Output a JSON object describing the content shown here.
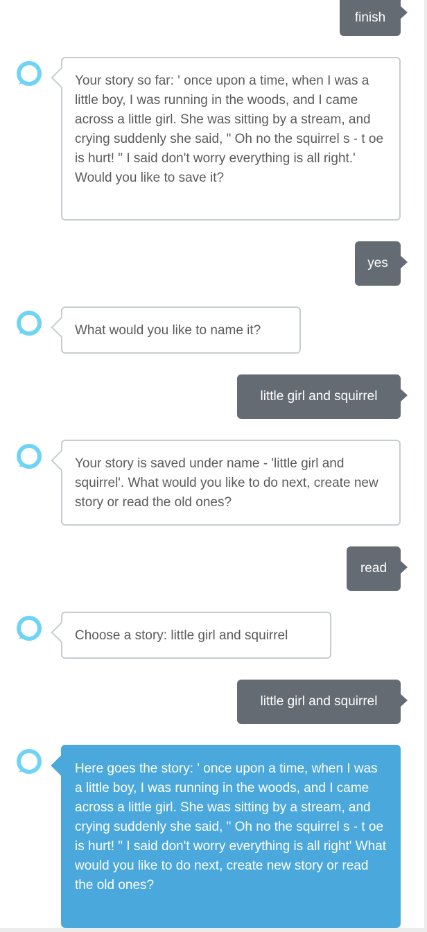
{
  "accent_colors": {
    "user_bubble": "#646b73",
    "bot_bubble_border": "#c7cdcf",
    "bot_highlight": "#4aa8dc",
    "avatar_ring": "#6fd4f4"
  },
  "icons": {
    "avatar": "alexa-ring-icon"
  },
  "messages": [
    {
      "sender": "user",
      "text": "finish"
    },
    {
      "sender": "bot",
      "text": "Your story so far: ' once upon a time, when I was a little boy, I was running in the woods, and I came across a little girl. She was sitting by a stream, and crying suddenly she said, \" Oh no the squirrel s - t oe is hurt! \" I said don't worry everything is all right.' Would you like to save it?"
    },
    {
      "sender": "user",
      "text": "yes"
    },
    {
      "sender": "bot",
      "text": "What would you like to name it?"
    },
    {
      "sender": "user",
      "text": "little girl and squirrel"
    },
    {
      "sender": "bot",
      "text": "Your story is saved under name - 'little girl and squirrel'. What would you like to do next, create new story or read the old ones?"
    },
    {
      "sender": "user",
      "text": "read"
    },
    {
      "sender": "bot",
      "text": "Choose a story: little girl and squirrel"
    },
    {
      "sender": "user",
      "text": "little girl and squirrel"
    },
    {
      "sender": "bot",
      "text": "Here goes the story: ' once upon a time, when I was a little boy, I was running in the woods, and I came across a little girl. She was sitting by a stream, and crying suddenly she said, \" Oh no the squirrel s - t oe is hurt! \" I said don't worry everything is all right' What would you like to do next, create new story or read the old ones?"
    }
  ]
}
